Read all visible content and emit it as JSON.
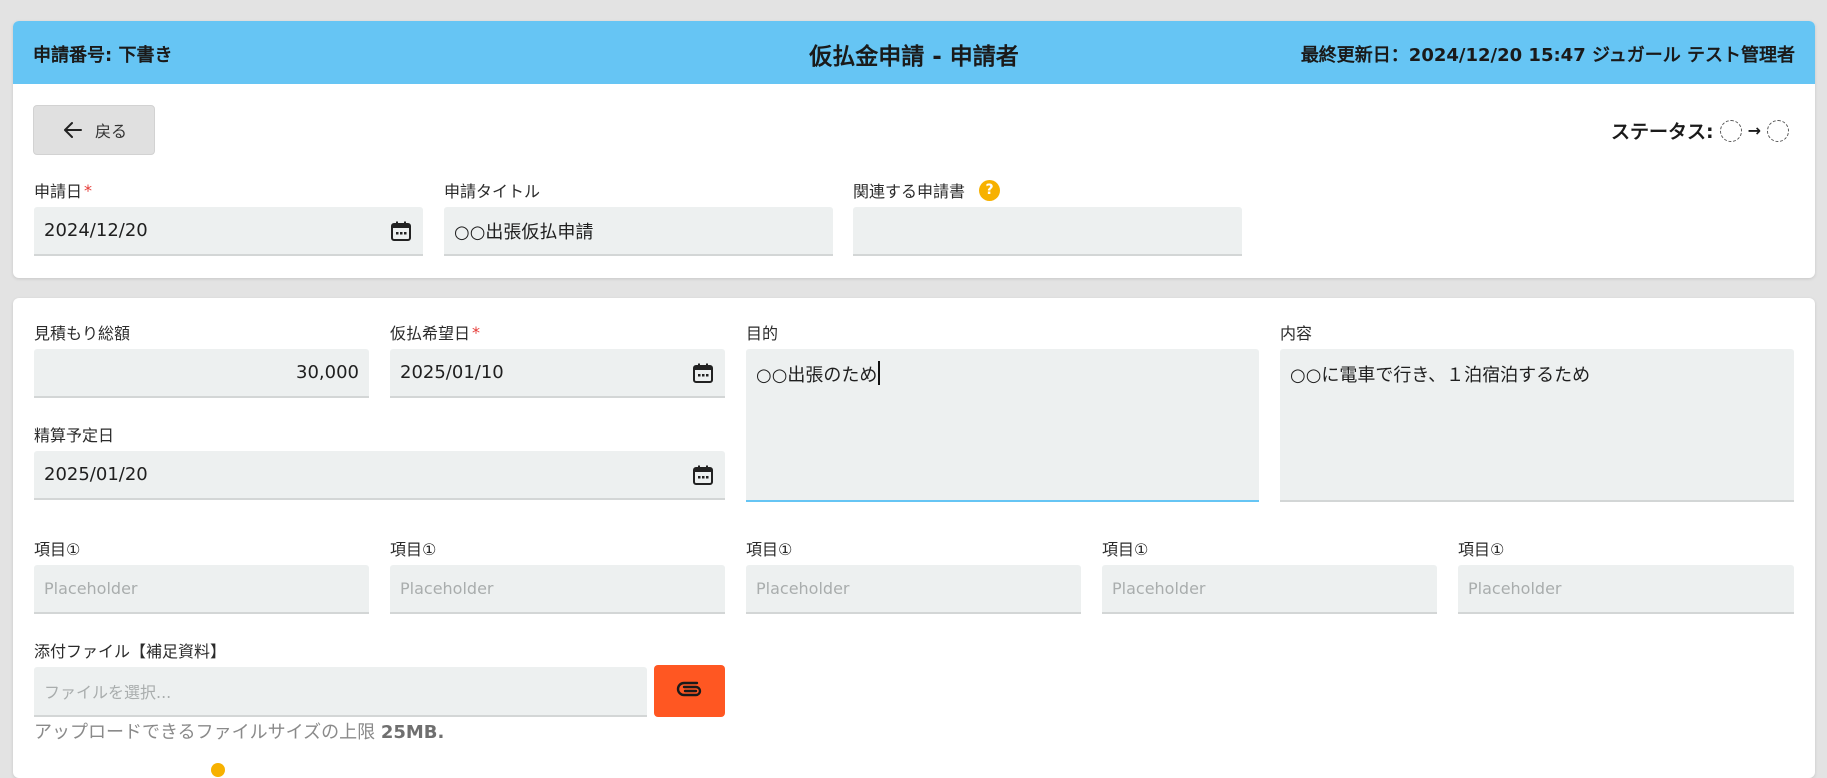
{
  "header": {
    "application_number": "申請番号: 下書き",
    "title": "仮払金申請 - 申請者",
    "last_updated": "最終更新日：2024/12/20 15:47 ジュガール テスト管理者"
  },
  "back_button": {
    "label": "戻る"
  },
  "status": {
    "label": "ステータス:",
    "arrow": "→"
  },
  "top_form": {
    "application_date": {
      "label": "申請日",
      "required_mark": "*",
      "value": "2024/12/20"
    },
    "application_title": {
      "label": "申請タイトル",
      "value": "○○出張仮払申請"
    },
    "related_application": {
      "label": "関連する申請書",
      "help": "?",
      "value": ""
    }
  },
  "main_form": {
    "estimate_total": {
      "label": "見積もり総額",
      "value": "30,000"
    },
    "desired_date": {
      "label": "仮払希望日",
      "required_mark": "*",
      "value": "2025/01/10"
    },
    "purpose": {
      "label": "目的",
      "value": "○○出張のため"
    },
    "content": {
      "label": "内容",
      "value": "○○に電車で行き、１泊宿泊するため"
    },
    "settlement_date": {
      "label": "精算予定日",
      "value": "2025/01/20"
    },
    "items": [
      {
        "label": "項目①",
        "placeholder": "Placeholder"
      },
      {
        "label": "項目①",
        "placeholder": "Placeholder"
      },
      {
        "label": "項目①",
        "placeholder": "Placeholder"
      },
      {
        "label": "項目①",
        "placeholder": "Placeholder"
      },
      {
        "label": "項目①",
        "placeholder": "Placeholder"
      }
    ],
    "attachment": {
      "label": "添付ファイル【補足資料】",
      "placeholder": "ファイルを選択...",
      "note_prefix": "アップロードできるファイルサイズの上限 ",
      "note_limit": "25MB."
    }
  },
  "colors": {
    "header_bg": "#66c5f4",
    "attach_button": "#ff5722",
    "help_icon": "#f7b100",
    "required": "#e53935"
  }
}
